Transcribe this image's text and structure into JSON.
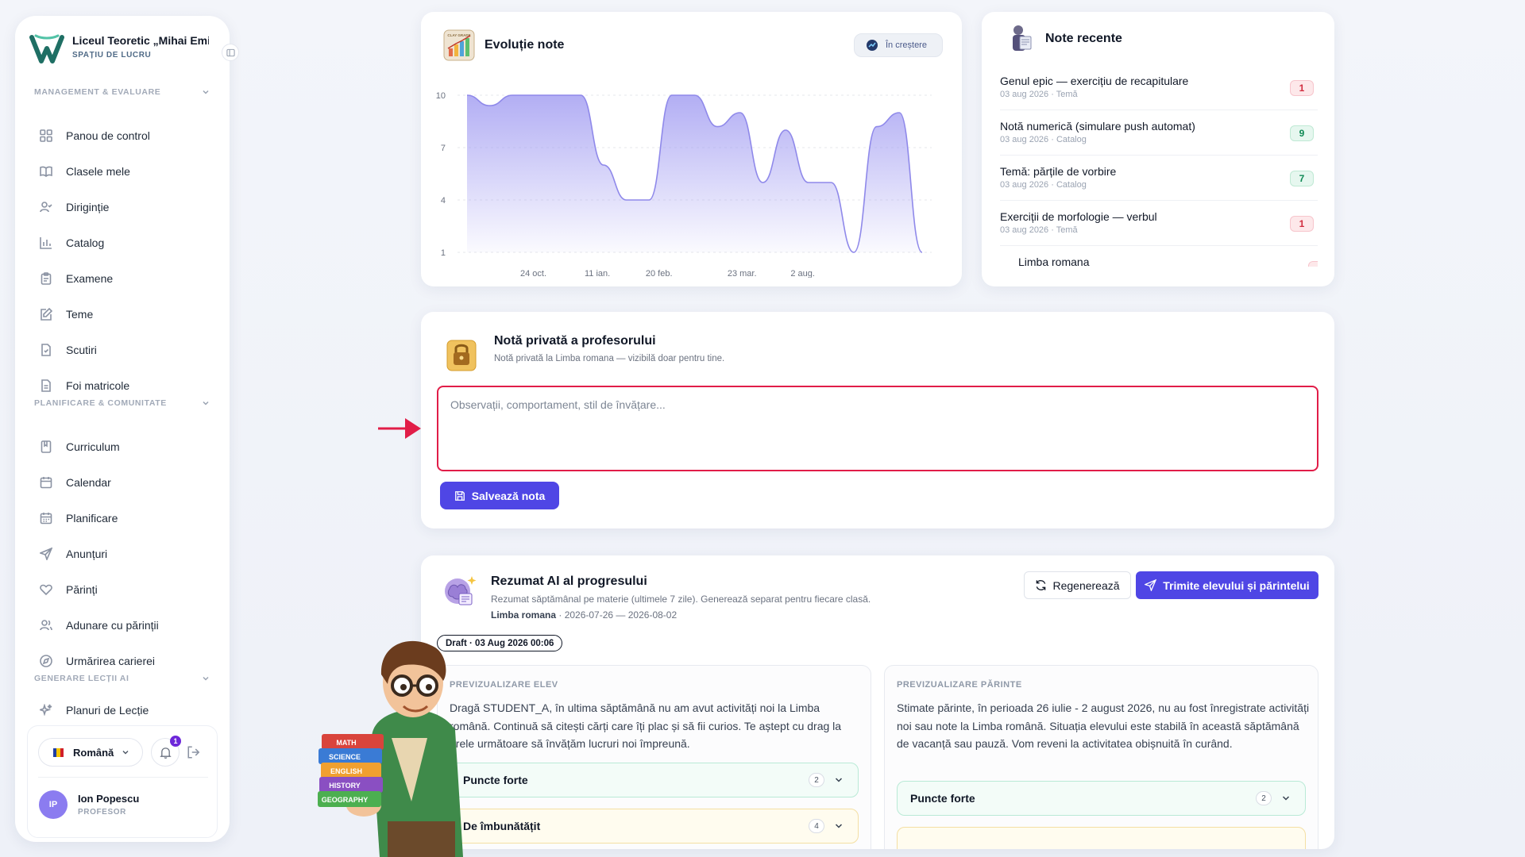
{
  "sidebar": {
    "school_name": "Liceul Teoretic „Mihai Emi...",
    "workspace_label": "SPAȚIU DE LUCRU",
    "sections": [
      {
        "label": "MANAGEMENT & EVALUARE"
      },
      {
        "label": "PLANIFICARE & COMUNITATE"
      },
      {
        "label": "GENERARE LECȚII AI"
      }
    ],
    "items": [
      {
        "label": "Panou de control",
        "icon": "grid-icon"
      },
      {
        "label": "Clasele mele",
        "icon": "book-icon"
      },
      {
        "label": "Diriginție",
        "icon": "user-check-icon"
      },
      {
        "label": "Catalog",
        "icon": "bar-chart-icon"
      },
      {
        "label": "Examene",
        "icon": "clipboard-icon"
      },
      {
        "label": "Teme",
        "icon": "edit-icon"
      },
      {
        "label": "Scutiri",
        "icon": "file-check-icon"
      },
      {
        "label": "Foi matricole",
        "icon": "file-text-icon"
      },
      {
        "label": "Curriculum",
        "icon": "book-bookmark-icon"
      },
      {
        "label": "Calendar",
        "icon": "calendar-icon"
      },
      {
        "label": "Planificare",
        "icon": "calendar-grid-icon"
      },
      {
        "label": "Anunțuri",
        "icon": "send-icon"
      },
      {
        "label": "Părinți",
        "icon": "heart-icon"
      },
      {
        "label": "Adunare cu părinții",
        "icon": "users-icon"
      },
      {
        "label": "Urmărirea carierei",
        "icon": "compass-icon"
      },
      {
        "label": "Planuri de Lecție",
        "icon": "sparkles-icon"
      }
    ],
    "language": "Română",
    "notifications_count": "1",
    "user": {
      "initials": "IP",
      "name": "Ion Popescu",
      "role": "PROFESOR"
    }
  },
  "chart_card": {
    "title": "Evoluție note",
    "trend_label": "În creștere",
    "icon_label": "CLAY GRADE"
  },
  "chart_data": {
    "type": "area",
    "title": "Evoluție note",
    "yticks": [
      "10",
      "7",
      "4",
      "1"
    ],
    "ylim": [
      1,
      10
    ],
    "xticks": [
      "24 oct.",
      "11 ian.",
      "20 feb.",
      "23 mar.",
      "2 aug."
    ],
    "series": [
      {
        "values": [
          10,
          9.4,
          10,
          10,
          10,
          10,
          6,
          4,
          4,
          10,
          10,
          8.2,
          9,
          5,
          8,
          5,
          5,
          1,
          8.2,
          9,
          1
        ]
      }
    ],
    "color": "#a5a0f2",
    "grid": true
  },
  "recent": {
    "title": "Note recente",
    "items": [
      {
        "name": "Genul epic — exercițiu de recapitulare",
        "meta": "03 aug 2026 · Temă",
        "grade": "1",
        "tone": "red"
      },
      {
        "name": "Notă numerică (simulare push automat)",
        "meta": "03 aug 2026 · Catalog",
        "grade": "9",
        "tone": "green"
      },
      {
        "name": "Temă: părțile de vorbire",
        "meta": "03 aug 2026 · Catalog",
        "grade": "7",
        "tone": "green"
      },
      {
        "name": "Exerciții de morfologie — verbul",
        "meta": "03 aug 2026 · Temă",
        "grade": "1",
        "tone": "red"
      },
      {
        "name": "Limba romana",
        "meta": "",
        "grade": "",
        "tone": "red"
      }
    ]
  },
  "private_note": {
    "title": "Notă privată a profesorului",
    "subtitle": "Notă privată la Limba romana — vizibilă doar pentru tine.",
    "placeholder": "Observații, comportament, stil de învățare...",
    "save_label": "Salvează nota"
  },
  "ai_summary": {
    "title": "Rezumat AI al progresului",
    "subtitle": "Rezumat săptămânal pe materie (ultimele 7 zile). Generează separat pentru fiecare clasă.",
    "subject": "Limba romana",
    "period": " · 2026-07-26 — 2026-08-02",
    "regenerate_label": "Regenerează",
    "send_label": "Trimite elevului și părintelui",
    "draft_label": "Draft · 03 Aug 2026 00:06",
    "student": {
      "heading": "PREVIZUALIZARE ELEV",
      "text": "Dragă STUDENT_A, în ultima săptămână nu am avut activități noi la Limba română. Continuă să citești cărți care îți plac și să fii curios. Te aștept cu drag la orele următoare să învățăm lucruri noi împreună.",
      "strengths_label": "Puncte forte",
      "strengths_count": "2",
      "improve_label": "De îmbunătățit",
      "improve_count": "4"
    },
    "parent": {
      "heading": "PREVIZUALIZARE PĂRINTE",
      "text": "Stimate părinte, în perioada 26 iulie - 2 august 2026, nu au fost înregistrate activități noi sau note la Limba română. Situația elevului este stabilă în această săptămână de vacanță sau pauză. Vom reveni la activitatea obișnuită în curând.",
      "strengths_label": "Puncte forte",
      "strengths_count": "2"
    }
  },
  "mascot": {
    "books": [
      "MATH",
      "SCIENCE",
      "ENGLISH",
      "HISTORY",
      "GEOGRAPHY"
    ]
  },
  "colors": {
    "accent": "#4f46e5",
    "danger_outline": "#e11d48",
    "chart_fill": "#a5a0f2"
  }
}
